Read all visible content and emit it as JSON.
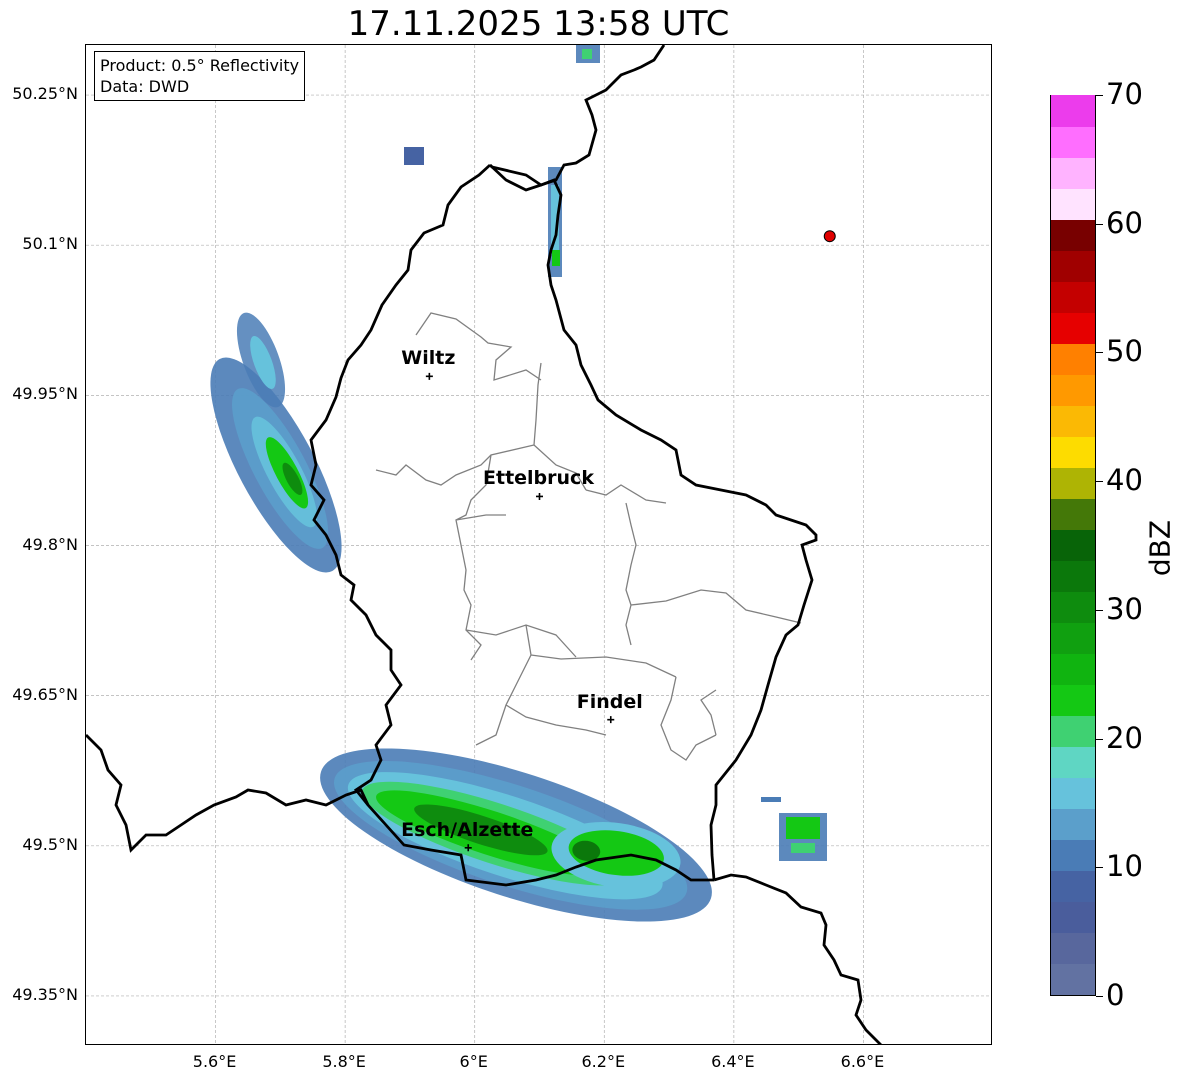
{
  "title": "17.11.2025 13:58 UTC",
  "info": {
    "product": "Product: 0.5° Reflectivity",
    "source": "Data: DWD"
  },
  "axes": {
    "lat_labels": [
      "50.25°N",
      "50.1°N",
      "49.95°N",
      "49.8°N",
      "49.65°N",
      "49.5°N",
      "49.35°N"
    ],
    "lon_labels": [
      "5.6°E",
      "5.8°E",
      "6°E",
      "6.2°E",
      "6.4°E",
      "6.6°E"
    ],
    "lat_values": [
      50.25,
      50.1,
      49.95,
      49.8,
      49.65,
      49.5,
      49.35
    ],
    "lon_values": [
      5.6,
      5.8,
      6.0,
      6.2,
      6.4,
      6.6
    ],
    "lon_range": [
      5.4,
      6.8
    ],
    "lat_range": [
      49.3,
      50.3
    ],
    "grid": true
  },
  "cities": [
    {
      "name": "Wiltz",
      "lon": 5.93,
      "lat": 49.969
    },
    {
      "name": "Ettelbruck",
      "lon": 6.1,
      "lat": 49.849
    },
    {
      "name": "Findel",
      "lon": 6.21,
      "lat": 49.626
    },
    {
      "name": "Esch/Alzette",
      "lon": 5.99,
      "lat": 49.498
    }
  ],
  "radar_site": {
    "lon": 6.548,
    "lat": 50.109,
    "color": "#e00000"
  },
  "colorbar": {
    "label": "dBZ",
    "ticks": [
      "0",
      "10",
      "20",
      "30",
      "40",
      "50",
      "60",
      "70"
    ],
    "min": 0,
    "max": 70,
    "colors": [
      "#6272a2",
      "#58679d",
      "#4a5d9c",
      "#4663a3",
      "#4a7cb6",
      "#5b9fcb",
      "#66c2dc",
      "#5fd6c3",
      "#3fd172",
      "#14c814",
      "#10b410",
      "#10a010",
      "#0e8c0e",
      "#0b780b",
      "#086408",
      "#447808",
      "#aeb404",
      "#fddc00",
      "#fbb904",
      "#ff9900",
      "#ff8000",
      "#e60000",
      "#c40000",
      "#a00000",
      "#780000",
      "#ffe3ff",
      "#ffb3ff",
      "#ff6eff",
      "#ec3cec"
    ]
  }
}
